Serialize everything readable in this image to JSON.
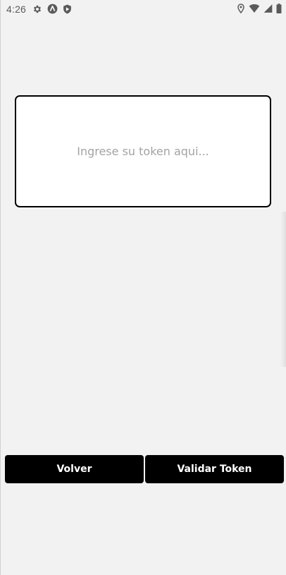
{
  "status_bar": {
    "time": "4:26",
    "left_icons": [
      "gear-icon",
      "app-a-icon",
      "shield-play-icon"
    ],
    "right_icons": [
      "location-icon",
      "wifi-icon",
      "signal-icon",
      "battery-icon"
    ]
  },
  "token_form": {
    "placeholder": "Ingrese su token aqui...",
    "value": ""
  },
  "actions": {
    "back_label": "Volver",
    "validate_label": "Validar Token"
  },
  "colors": {
    "background": "#f2f2f2",
    "button_bg": "#000000",
    "button_text": "#ffffff",
    "card_border": "#000000",
    "placeholder": "#a3a3a3"
  }
}
